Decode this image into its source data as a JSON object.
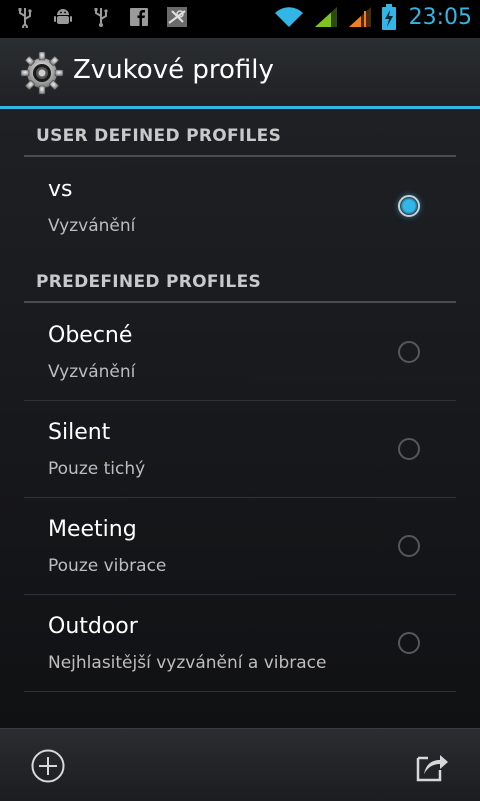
{
  "status_bar": {
    "time": "23:05",
    "accent_color": "#33b5e5",
    "notification_icons": [
      "usb-icon",
      "android-debug-icon",
      "usb-icon",
      "facebook-icon",
      "app-icon"
    ]
  },
  "action_bar": {
    "title": "Zvukové profily",
    "icon": "gear-icon"
  },
  "sections": {
    "user_defined": {
      "header": "USER DEFINED PROFILES",
      "items": [
        {
          "title": "vs",
          "subtitle": "Vyzvánění",
          "selected": true
        }
      ]
    },
    "predefined": {
      "header": "PREDEFINED PROFILES",
      "items": [
        {
          "title": "Obecné",
          "subtitle": "Vyzvánění",
          "selected": false
        },
        {
          "title": "Silent",
          "subtitle": "Pouze tichý",
          "selected": false
        },
        {
          "title": "Meeting",
          "subtitle": "Pouze vibrace",
          "selected": false
        },
        {
          "title": "Outdoor",
          "subtitle": "Nejhlasitější vyzvánění a vibrace",
          "selected": false
        }
      ]
    }
  },
  "bottom_bar": {
    "left_icon": "add-circle-icon",
    "right_icon": "share-icon"
  }
}
